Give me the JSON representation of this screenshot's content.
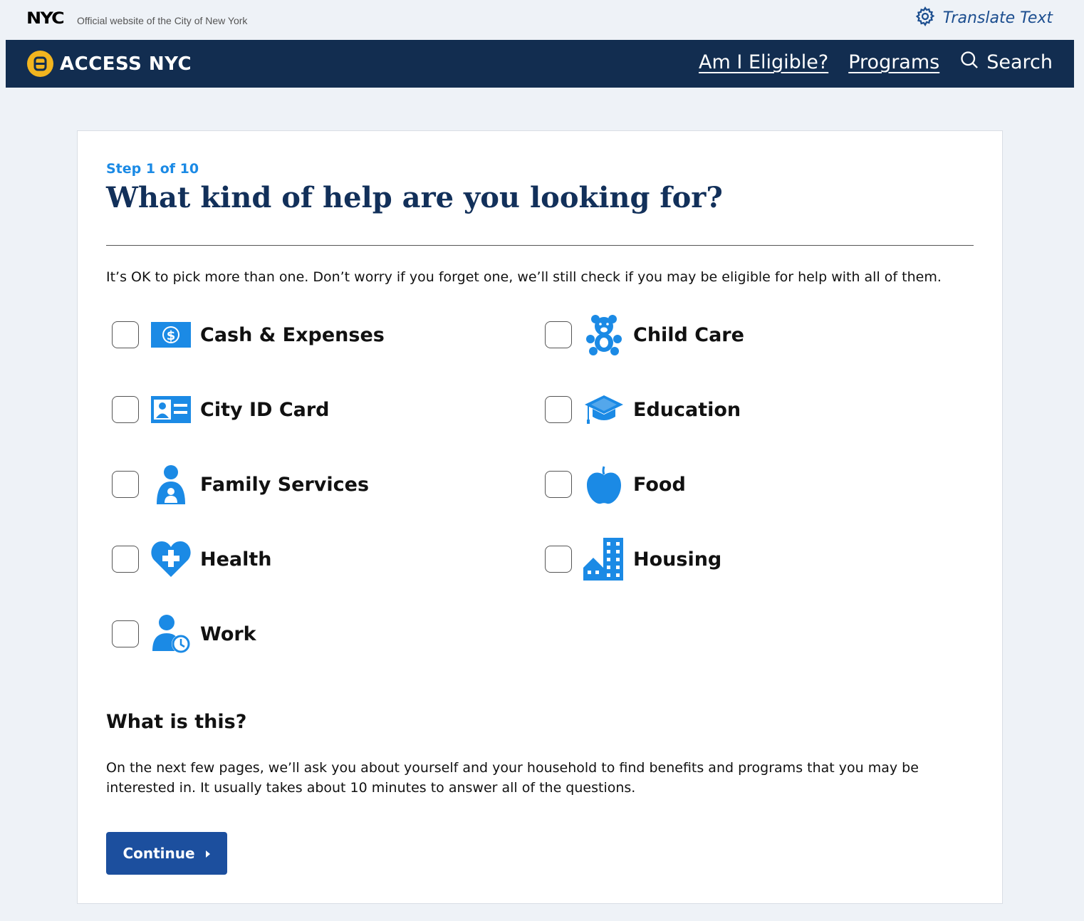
{
  "topbar": {
    "logo": "NYC",
    "official_text": "Official website of the City of New York",
    "translate_label": "Translate Text"
  },
  "navbar": {
    "brand": "ACCESS NYC",
    "links": [
      "Am I Eligible?",
      "Programs"
    ],
    "search_label": "Search"
  },
  "form": {
    "step": "Step 1 of 10",
    "heading": "What kind of help are you looking for?",
    "intro": "It’s OK to pick more than one. Don’t worry if you forget one, we’ll still check if you may be eligible for help with all of them.",
    "options": [
      {
        "label": "Cash & Expenses",
        "icon": "cash-icon",
        "checked": false
      },
      {
        "label": "Child Care",
        "icon": "teddy-bear-icon",
        "checked": false
      },
      {
        "label": "City ID Card",
        "icon": "id-card-icon",
        "checked": false
      },
      {
        "label": "Education",
        "icon": "graduation-cap-icon",
        "checked": false
      },
      {
        "label": "Family Services",
        "icon": "family-icon",
        "checked": false
      },
      {
        "label": "Food",
        "icon": "apple-icon",
        "checked": false
      },
      {
        "label": "Health",
        "icon": "heart-plus-icon",
        "checked": false
      },
      {
        "label": "Housing",
        "icon": "buildings-icon",
        "checked": false
      },
      {
        "label": "Work",
        "icon": "person-clock-icon",
        "checked": false
      }
    ],
    "info_heading": "What is this?",
    "info_text": "On the next few pages, we’ll ask you about yourself and your household to find benefits and programs that you may be interested in. It usually takes about 10 minutes to answer all of the questions.",
    "continue_label": "Continue"
  },
  "colors": {
    "navbar": "#122d50",
    "brand_accent": "#f2b51f",
    "icon_blue": "#1b8ae5",
    "button": "#1c4f9e",
    "heading": "#12305a"
  }
}
